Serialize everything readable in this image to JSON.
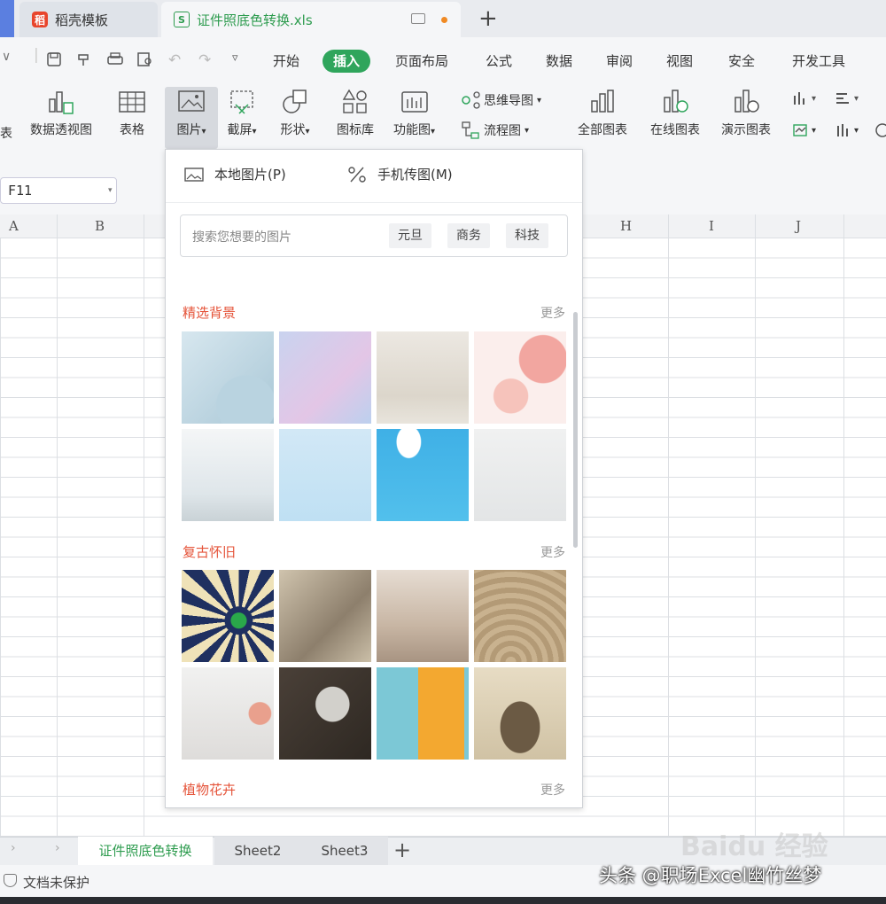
{
  "tabs": {
    "template_tab": "稻壳模板",
    "file_tab": "证件照底色转换.xls",
    "logo_template": "稻",
    "logo_file": "S",
    "new_tab": "+"
  },
  "menu": {
    "items": [
      "开始",
      "插入",
      "页面布局",
      "公式",
      "数据",
      "审阅",
      "视图",
      "安全",
      "开发工具"
    ],
    "active": "插入"
  },
  "ribbon": {
    "partial_left": "表",
    "pivot_chart": "数据透视图",
    "table": "表格",
    "picture": "图片",
    "screenshot": "截屏",
    "shapes": "形状",
    "icon_library": "图标库",
    "function_chart": "功能图",
    "mind_map": "思维导图",
    "flow_chart": "流程图",
    "all_charts": "全部图表",
    "online_charts": "在线图表",
    "demo_charts": "演示图表",
    "dropdown_glyph": "▾"
  },
  "namebox": {
    "value": "F11",
    "arrow": "▾"
  },
  "columns": [
    "A",
    "B",
    "H",
    "I",
    "J"
  ],
  "picture_panel": {
    "local_picture": "本地图片(P)",
    "phone_picture": "手机传图(M)",
    "search_placeholder": "搜索您想要的图片",
    "chips": [
      "元旦",
      "商务",
      "科技"
    ],
    "sections": [
      {
        "title": "精选背景",
        "more": "更多"
      },
      {
        "title": "复古怀旧",
        "more": "更多"
      },
      {
        "title": "植物花卉",
        "more": "更多"
      }
    ]
  },
  "sheets": {
    "tabs": [
      "证件照底色转换",
      "Sheet2",
      "Sheet3"
    ],
    "add": "+",
    "nav": "› ›"
  },
  "status": {
    "protection": "文档未保护"
  },
  "watermark": {
    "text": "头条 @职场Excel幽竹丝梦",
    "baidu": "Baidu 经验"
  },
  "colors": {
    "accent_green": "#2fa55c",
    "section_red": "#e5543a",
    "tab_bg": "#e9ebef"
  }
}
